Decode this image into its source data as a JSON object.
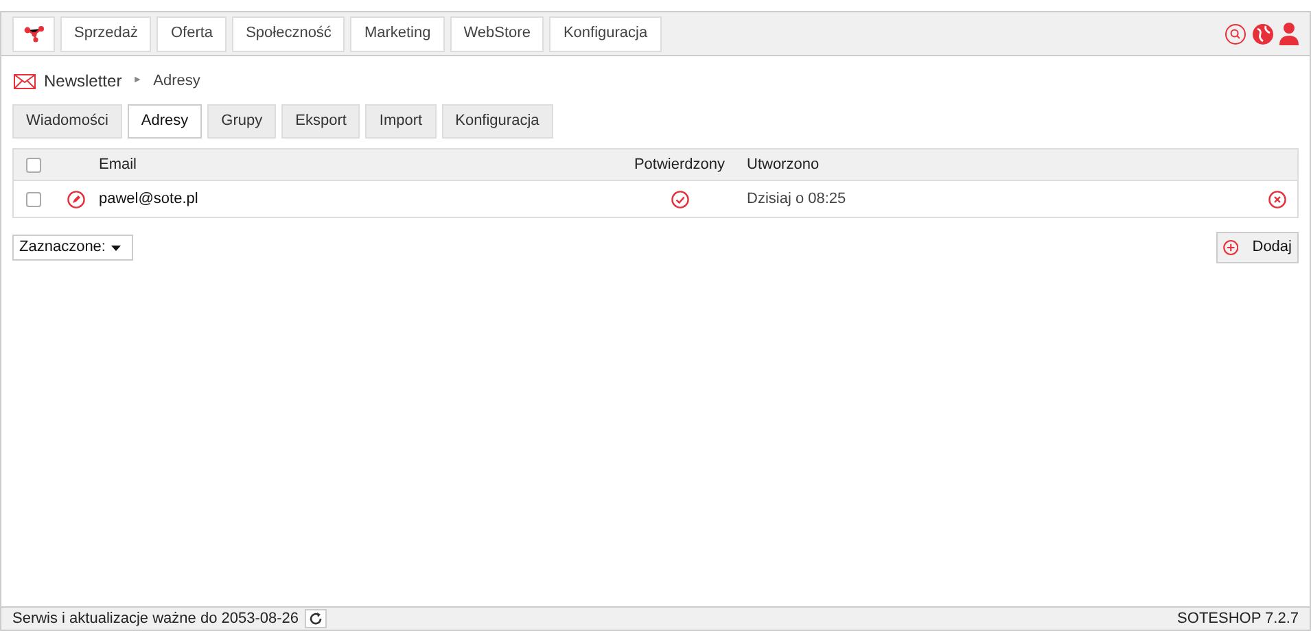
{
  "top_nav": {
    "items": [
      "Sprzedaż",
      "Oferta",
      "Społeczność",
      "Marketing",
      "WebStore",
      "Konfiguracja"
    ]
  },
  "breadcrumb": {
    "section": "Newsletter",
    "separator": "►",
    "current": "Adresy"
  },
  "tabs": [
    {
      "label": "Wiadomości",
      "selected": false
    },
    {
      "label": "Adresy",
      "selected": true
    },
    {
      "label": "Grupy",
      "selected": false
    },
    {
      "label": "Eksport",
      "selected": false
    },
    {
      "label": "Import",
      "selected": false
    },
    {
      "label": "Konfiguracja",
      "selected": false
    }
  ],
  "table": {
    "select_all_checked": false,
    "columns": [
      "Email",
      "Potwierdzony",
      "Utworzono"
    ],
    "rows": [
      {
        "checked": false,
        "email": "pawel@sote.pl",
        "confirmed": true,
        "created": "Dzisiaj o 08:25"
      }
    ]
  },
  "bulk_select": {
    "value": "Zaznaczone:"
  },
  "add_button": {
    "label": "Dodaj"
  },
  "status_bar": {
    "license": "Serwis i aktualizacje ważne do 2053-08-26",
    "version": "SOTESHOP 7.2.7"
  }
}
